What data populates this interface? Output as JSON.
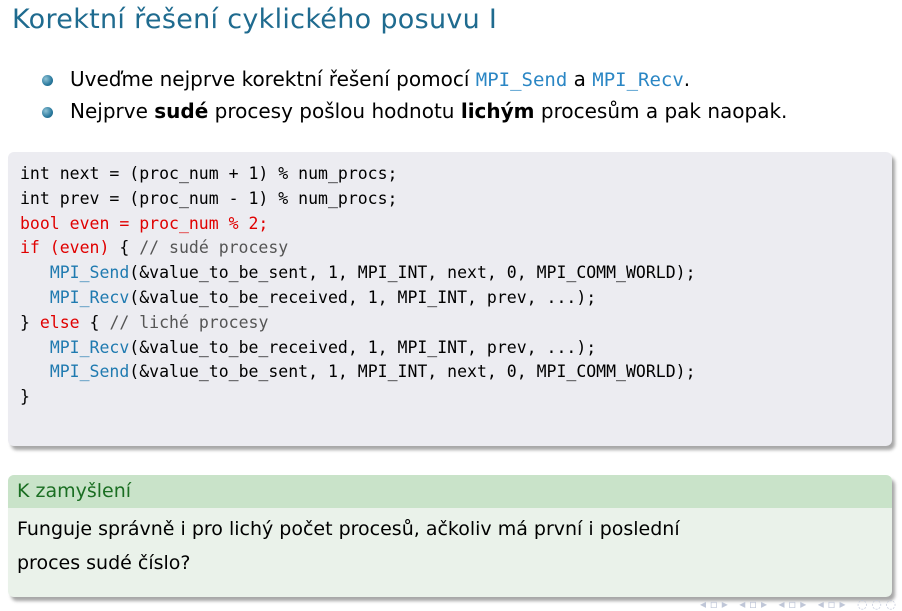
{
  "slide": {
    "title": "Korektní řešení cyklického posuvu I"
  },
  "bullets": [
    {
      "pre": "Uveďme nejprve korektní řešení pomocí ",
      "code1": "MPI_Send",
      "mid": " a ",
      "code2": "MPI_Recv",
      "post": "."
    },
    {
      "pre": "Nejprve ",
      "bold1": "sudé",
      "mid": " procesy pošlou hodnotu ",
      "bold2": "lichým",
      "post": " procesům a pak naopak."
    }
  ],
  "code": {
    "l1": "int next = (proc_num + 1) % num_procs;",
    "l2": "int prev = (proc_num - 1) % num_procs;",
    "l3": "bool even = proc_num % 2;",
    "l4_kw": "if (even)",
    "l4_mid": " { ",
    "l4_cmt": "// sudé procesy",
    "l5_indent": "   ",
    "l5_fn": "MPI_Send",
    "l5_args": "(&value_to_be_sent, 1, MPI_INT, next, 0, MPI_COMM_WORLD);",
    "l6_indent": "   ",
    "l6_fn": "MPI_Recv",
    "l6_args": "(&value_to_be_received, 1, MPI_INT, prev, ...);",
    "l7_pre": "} ",
    "l7_kw": "else",
    "l7_mid": " { ",
    "l7_cmt": "// liché procesy",
    "l8_indent": "   ",
    "l8_fn": "MPI_Recv",
    "l8_args": "(&value_to_be_received, 1, MPI_INT, prev, ...);",
    "l9_indent": "   ",
    "l9_fn": "MPI_Send",
    "l9_args": "(&value_to_be_sent, 1, MPI_INT, next, 0, MPI_COMM_WORLD);",
    "l10": "}"
  },
  "note": {
    "title": "K zamyšlení",
    "line1": "Funguje správně i pro lichý počet procesů, ačkoliv má první i poslední",
    "line2": "proces sudé číslo?"
  },
  "colors": {
    "title": "#1f6b8f",
    "code_ref": "#2a86c4",
    "keyword_red": "#e00000",
    "function_blue": "#1f7ab0",
    "block_title_green": "#1a6e22"
  },
  "icons": {
    "bullet": "bullet-ball-icon",
    "navigation": "beamer-navigation-icon"
  }
}
